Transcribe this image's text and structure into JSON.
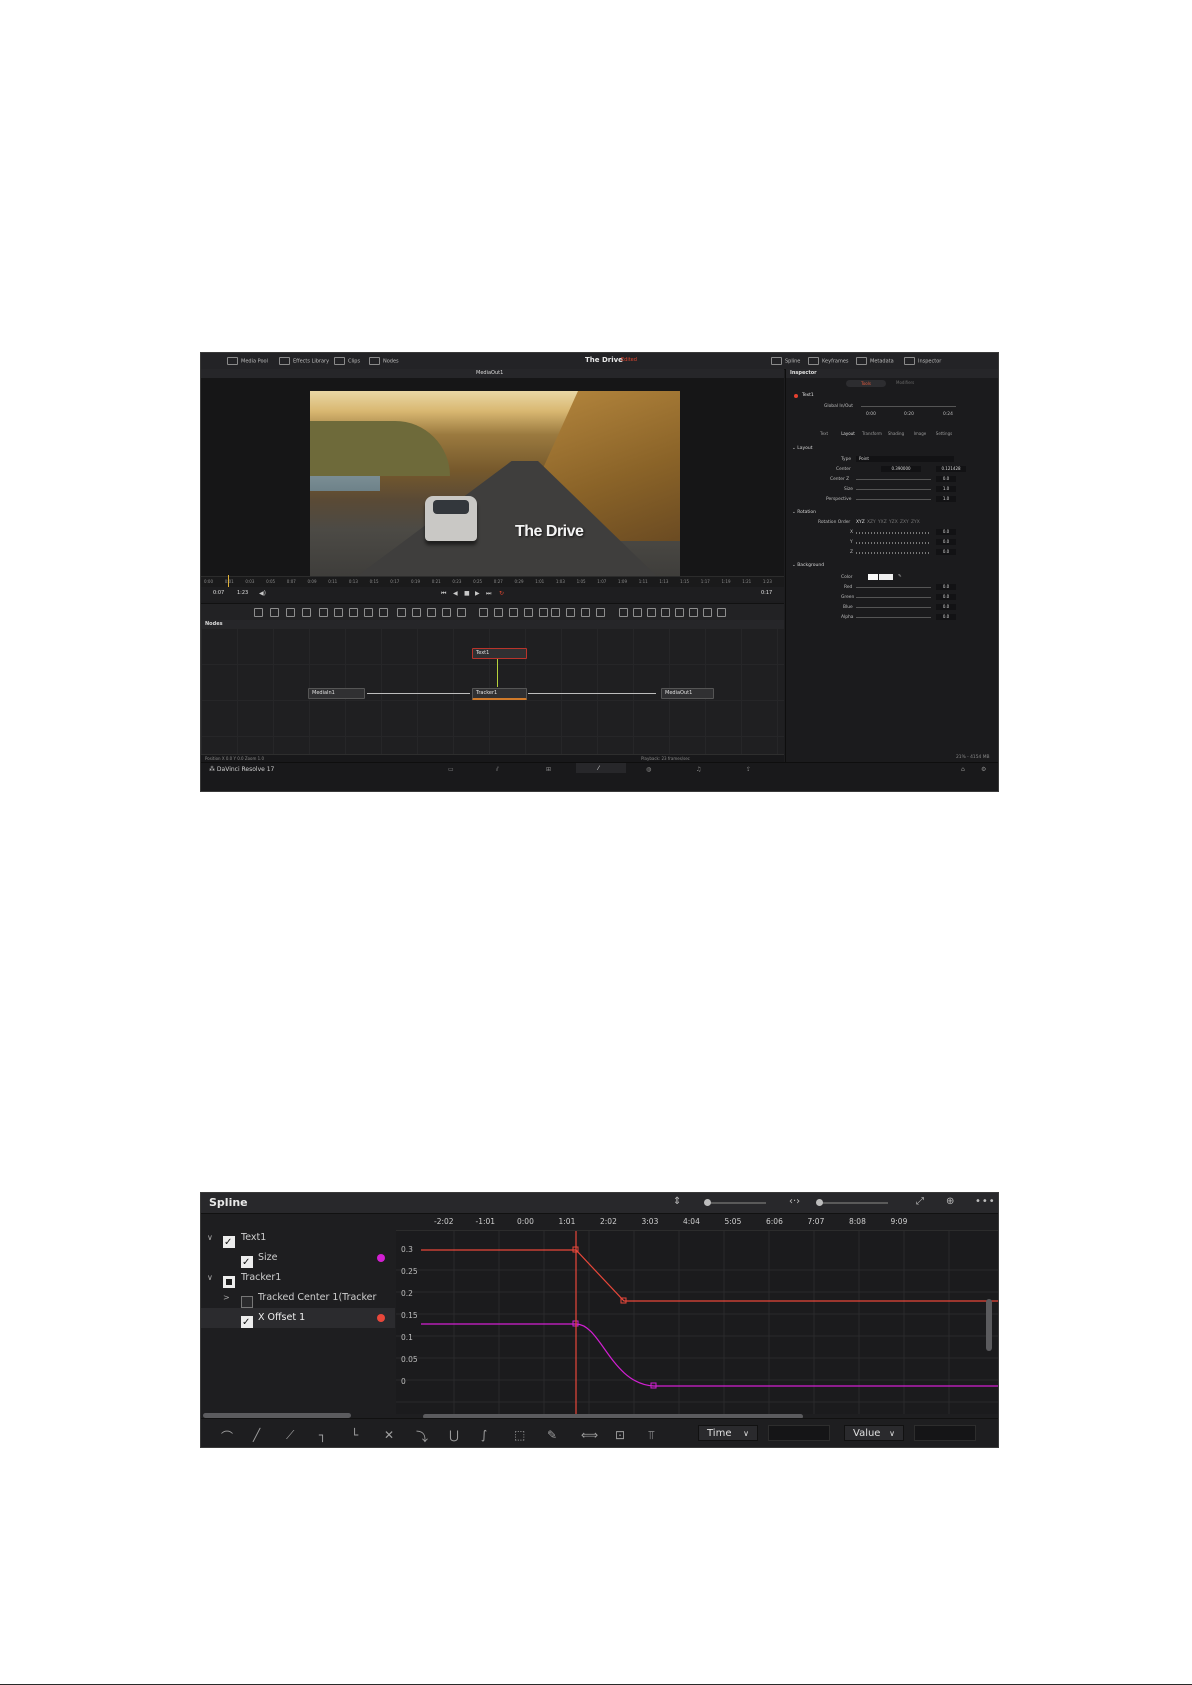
{
  "fusion": {
    "topbar": {
      "media_pool": "Media Pool",
      "effects_library": "Effects Library",
      "clips": "Clips",
      "nodes": "Nodes",
      "project_title": "The Drive",
      "project_status": "Edited",
      "spline": "Spline",
      "keyframes": "Keyframes",
      "metadata": "Metadata",
      "inspector": "Inspector"
    },
    "viewer": {
      "title": "MediaOut1",
      "overlay_text": "The Drive"
    },
    "ruler_ticks": [
      "0:00",
      "0:01",
      "0:03",
      "0:05",
      "0:07",
      "0:09",
      "0:11",
      "0:13",
      "0:15",
      "0:17",
      "0:19",
      "0:21",
      "0:23",
      "0:25",
      "0:27",
      "0:29",
      "1:01",
      "1:03",
      "1:05",
      "1:07",
      "1:09",
      "1:11",
      "1:13",
      "1:15",
      "1:17",
      "1:19",
      "1:21",
      "1:23"
    ],
    "transport": {
      "start_tc": "0:07",
      "end_tc": "1:23",
      "current_tc": "0:17"
    },
    "nodes_panel": {
      "title": "Nodes",
      "node_text": "Text1",
      "node_media_in": "MediaIn1",
      "node_tracker": "Tracker1",
      "node_media_out": "MediaOut1"
    },
    "status": {
      "left": "Position X 0.0  Y 0.0   Zoom 1.0",
      "playback": "Playback: 23 frames/sec",
      "memory": "21% - 4154 MB"
    },
    "app_name": "DaVinci Resolve 17",
    "inspector": {
      "title": "Inspector",
      "tab_tools": "Tools",
      "tab_modifiers": "Modifiers",
      "node_name": "Text1",
      "global_in_out_label": "Global In/Out",
      "global_in": "0:00",
      "global_mid": "0:20",
      "global_out": "0:24",
      "subtabs": [
        "Text",
        "Layout",
        "Transform",
        "Shading",
        "Image",
        "Settings"
      ],
      "layout_section": "Layout",
      "type_label": "Type",
      "type_value": "Point",
      "center_label": "Center",
      "center_x": "0.390000",
      "center_y": "0.121428",
      "center_z_label": "Center Z",
      "center_z": "0.0",
      "size_label": "Size",
      "size": "1.0",
      "perspective_label": "Perspective",
      "perspective": "1.0",
      "rotation_section": "Rotation",
      "rotation_order_label": "Rotation Order",
      "rotation_orders": [
        "XYZ",
        "XZY",
        "YXZ",
        "YZX",
        "ZXY",
        "ZYX"
      ],
      "rot_x": "0.0",
      "rot_y": "0.0",
      "rot_z": "0.0",
      "background_section": "Background",
      "color_label": "Color",
      "red_label": "Red",
      "red": "0.0",
      "green_label": "Green",
      "green": "0.0",
      "blue_label": "Blue",
      "blue": "0.0",
      "alpha_label": "Alpha",
      "alpha": "0.0"
    }
  },
  "spline": {
    "title": "Spline",
    "timeline_ticks": [
      "-2:02",
      "-1:01",
      "0:00",
      "1:01",
      "2:02",
      "3:03",
      "4:04",
      "5:05",
      "6:06",
      "7:07",
      "8:08",
      "9:09"
    ],
    "y_labels": [
      "0.3",
      "0.25",
      "0.2",
      "0.15",
      "0.1",
      "0.05",
      "0"
    ],
    "tree": [
      {
        "label": "Text1"
      },
      {
        "label": "Size"
      },
      {
        "label": "Tracker1"
      },
      {
        "label": "Tracked Center 1(Tracker"
      },
      {
        "label": "X Offset 1"
      }
    ],
    "colors": {
      "size_curve": "#d21fd2",
      "xoffset_dot": "#e8473a",
      "playhead": "#e8473a"
    },
    "time_dropdown": "Time",
    "value_dropdown": "Value"
  }
}
